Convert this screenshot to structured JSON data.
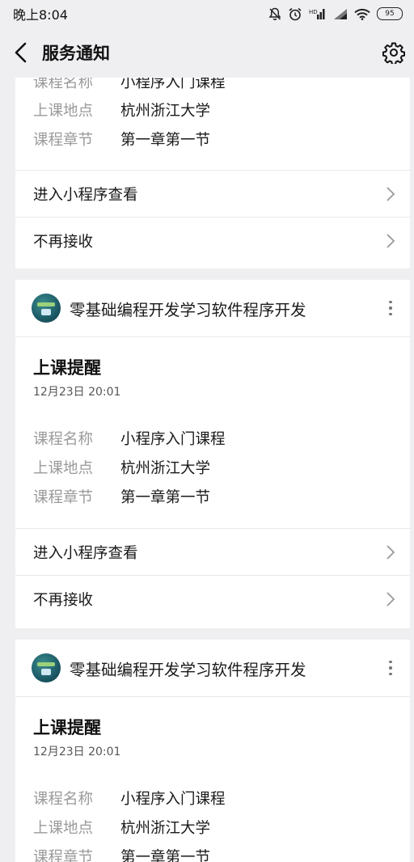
{
  "status_bar": {
    "time": "晚上8:04",
    "battery": "95"
  },
  "nav": {
    "title": "服务通知"
  },
  "cards": [
    {
      "fields": [
        {
          "label": "课程名称",
          "value": "小程序入门课程"
        },
        {
          "label": "上课地点",
          "value": "杭州浙江大学"
        },
        {
          "label": "课程章节",
          "value": "第一章第一节"
        }
      ],
      "actions": [
        {
          "label": "进入小程序查看"
        },
        {
          "label": "不再接收"
        }
      ]
    },
    {
      "name": "零基础编程开发学习软件程序开发",
      "notice_title": "上课提醒",
      "time": "12月23日  20:01",
      "fields": [
        {
          "label": "课程名称",
          "value": "小程序入门课程"
        },
        {
          "label": "上课地点",
          "value": "杭州浙江大学"
        },
        {
          "label": "课程章节",
          "value": "第一章第一节"
        }
      ],
      "actions": [
        {
          "label": "进入小程序查看"
        },
        {
          "label": "不再接收"
        }
      ]
    },
    {
      "name": "零基础编程开发学习软件程序开发",
      "notice_title": "上课提醒",
      "time": "12月23日  20:01",
      "fields": [
        {
          "label": "课程名称",
          "value": "小程序入门课程"
        },
        {
          "label": "上课地点",
          "value": "杭州浙江大学"
        },
        {
          "label": "课程章节",
          "value": "第一章第一节"
        }
      ]
    }
  ]
}
